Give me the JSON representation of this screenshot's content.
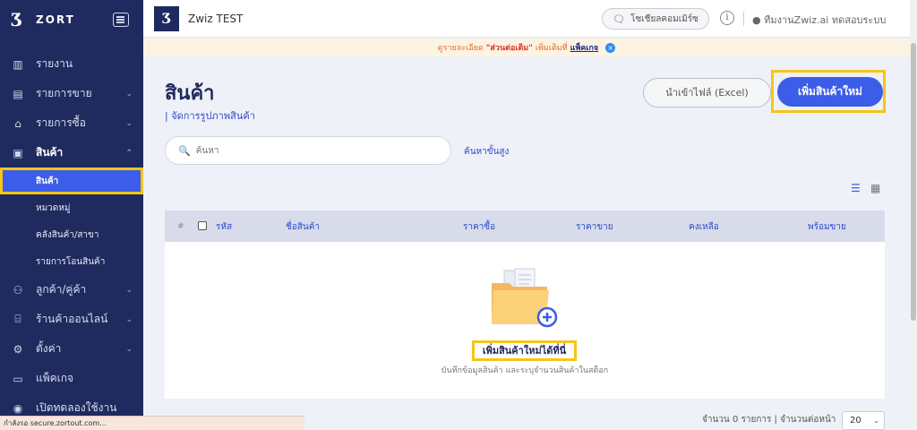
{
  "sidebar": {
    "brand_mark": "Ʒ",
    "brand_name": "ZORT",
    "items": [
      {
        "label": "รายงาน",
        "icon": "bar-chart-icon"
      },
      {
        "label": "รายการขาย",
        "icon": "clipboard-icon"
      },
      {
        "label": "รายการซื้อ",
        "icon": "basket-icon"
      },
      {
        "label": "สินค้า",
        "icon": "box-icon"
      },
      {
        "label": "ลูกค้า/คู่ค้า",
        "icon": "users-icon"
      },
      {
        "label": "ร้านค้าออนไลน์",
        "icon": "store-icon"
      },
      {
        "label": "ตั้งค่า",
        "icon": "gear-icon"
      },
      {
        "label": "แพ็คเกจ",
        "icon": "package-icon"
      },
      {
        "label": "เปิดทดลองใช้งาน",
        "icon": "play-icon"
      }
    ],
    "sub_items": [
      {
        "label": "สินค้า"
      },
      {
        "label": "หมวดหมู่"
      },
      {
        "label": "คลังสินค้า/สาขา"
      },
      {
        "label": "รายการโอนสินค้า"
      }
    ]
  },
  "header": {
    "workspace_logo": "Ʒ",
    "workspace_name": "Zwiz TEST",
    "social_commerce": "โซเชียลคอมเมิร์ซ",
    "info": "i",
    "user": "ทีมงานZwiz.ai ทดสอบระบบ"
  },
  "notice": {
    "prefix": "ดูรายละเอียด",
    "highlight": "\"ส่วนต่อเติม\"",
    "middle": "เพิ่มเติมที่",
    "link": "แพ็คเกจ",
    "close": "×"
  },
  "page": {
    "title": "สินค้า",
    "subtitle": "| จัดการรูปภาพสินค้า",
    "import_button": "นำเข้าไฟล์ (Excel)",
    "add_button": "เพิ่มสินค้าใหม่"
  },
  "search": {
    "placeholder": "ค้นหา",
    "advanced": "ค้นหาขั้นสูง"
  },
  "table": {
    "hash": "#",
    "columns": [
      "รหัส",
      "ชื่อสินค้า",
      "ราคาซื้อ",
      "ราคาขาย",
      "คงเหลือ",
      "พร้อมขาย"
    ],
    "empty_link": "เพิ่มสินค้าใหม่ได้ที่นี่",
    "empty_desc": "บันทึกข้อมูลสินค้า และระบุจำนวนสินค้าในสต็อก"
  },
  "pagination": {
    "summary": "จำนวน 0 รายการ | จำนวนต่อหน้า",
    "page_size": "20"
  },
  "status_bar": "กำลังรอ secure.zortout.com..."
}
